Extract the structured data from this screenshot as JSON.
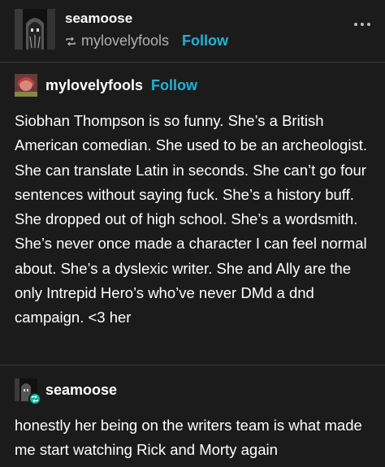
{
  "header": {
    "poster_name": "seamoose",
    "reblogged_from": "mylovelyfools",
    "follow_label": "Follow",
    "menu_icon": "more-horizontal-icon",
    "reblog_icon": "reblog-icon"
  },
  "trail": [
    {
      "blog_name": "mylovelyfools",
      "follow_label": "Follow",
      "text": "Siobhan Thompson is so funny. She’s a British American comedian. She used to be an archeologist. She can translate Latin in seconds. She can’t go four sentences without saying fuck. She’s a history buff. She dropped out of high school. She’s a wordsmith. She’s never once made a character I can feel normal about. She’s a dyslexic writer. She and Ally are the only Intrepid Hero’s who’ve never DMd a dnd campaign. <3 her"
    },
    {
      "blog_name": "seamoose",
      "badge_icon": "reblog-badge-icon",
      "text": "honestly her being on the writers team is what made me start watching Rick and Morty again"
    }
  ],
  "colors": {
    "background": "#1b1b1b",
    "follow": "#21b3d4",
    "muted": "#b0b0b0",
    "badge": "#00b8a0"
  }
}
